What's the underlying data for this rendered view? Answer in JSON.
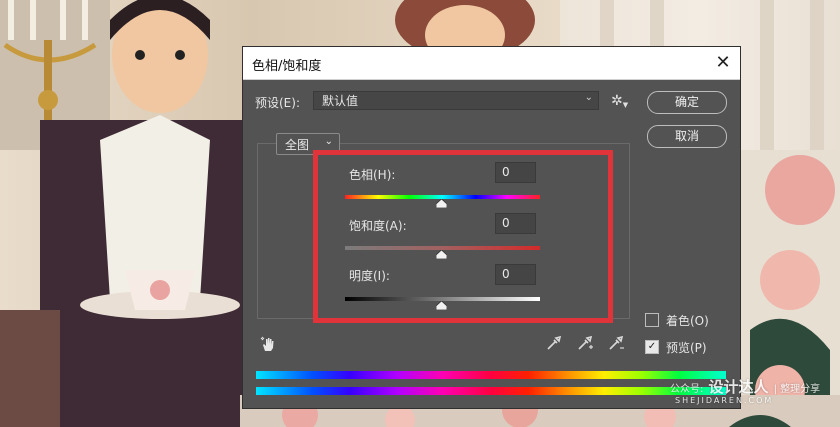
{
  "dialog": {
    "title": "色相/饱和度",
    "close_icon": "close-icon",
    "preset_label": "预设(E):",
    "preset_value": "默认值",
    "settings_icon": "gear-icon",
    "ok_label": "确定",
    "cancel_label": "取消",
    "range_value": "全图",
    "sliders": [
      {
        "label": "色相(H):",
        "value": "0"
      },
      {
        "label": "饱和度(A):",
        "value": "0"
      },
      {
        "label": "明度(I):",
        "value": "0"
      }
    ],
    "colorize_label": "着色(O)",
    "colorize_checked": false,
    "preview_label": "预览(P)",
    "preview_checked": true,
    "highlight_color": "#e0333a"
  },
  "watermark": {
    "prefix": "公众号:",
    "brand": "设计达人",
    "suffix": "| 整理分享",
    "url": "SHEJIDAREN.COM"
  }
}
